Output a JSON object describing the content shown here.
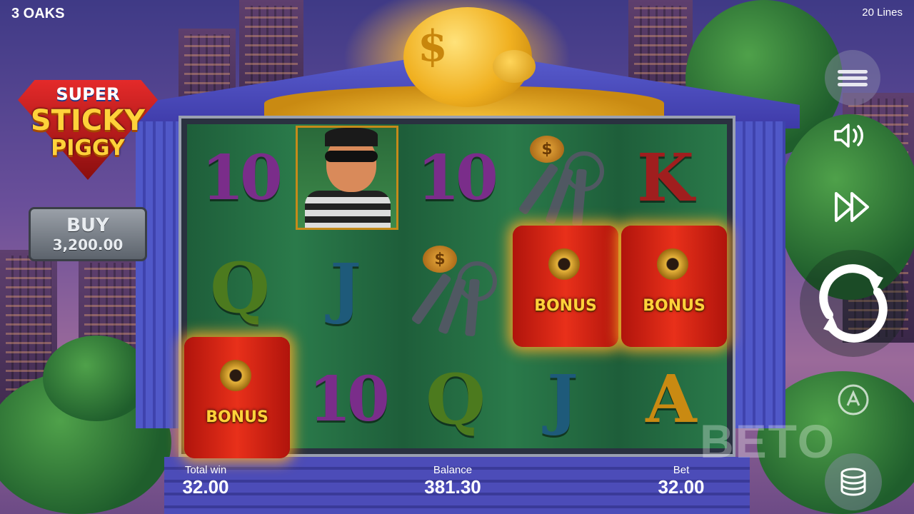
{
  "header": {
    "brand": "3 OAKS",
    "lines": "20 Lines"
  },
  "logo": {
    "line1": "SUPER",
    "line2": "STICKY",
    "line3": "PIGGY"
  },
  "buy": {
    "label": "BUY",
    "price": "3,200.00"
  },
  "reels": {
    "row1": [
      "10",
      "robber",
      "10",
      "keys",
      "K"
    ],
    "row2": [
      "Q",
      "J",
      "keys",
      "BONUS",
      "BONUS"
    ],
    "row3": [
      "BONUS",
      "10",
      "Q",
      "J",
      "A"
    ]
  },
  "symbols": {
    "ten": "10",
    "q": "Q",
    "j": "J",
    "k": "K",
    "a": "A",
    "bonus": "BONUS",
    "coin": "$"
  },
  "controls": {
    "menu_icon": "hamburger-menu-icon",
    "sound_icon": "speaker-icon",
    "turbo_icon": "fast-forward-icon",
    "spin_icon": "spin-arrows-icon",
    "auto_icon": "autoplay-icon",
    "stake_icon": "coin-stack-icon"
  },
  "stats": {
    "total_win_label": "Total win",
    "total_win": "32.00",
    "balance_label": "Balance",
    "balance": "381.30",
    "bet_label": "Bet",
    "bet": "32.00"
  },
  "watermark": "BETO"
}
